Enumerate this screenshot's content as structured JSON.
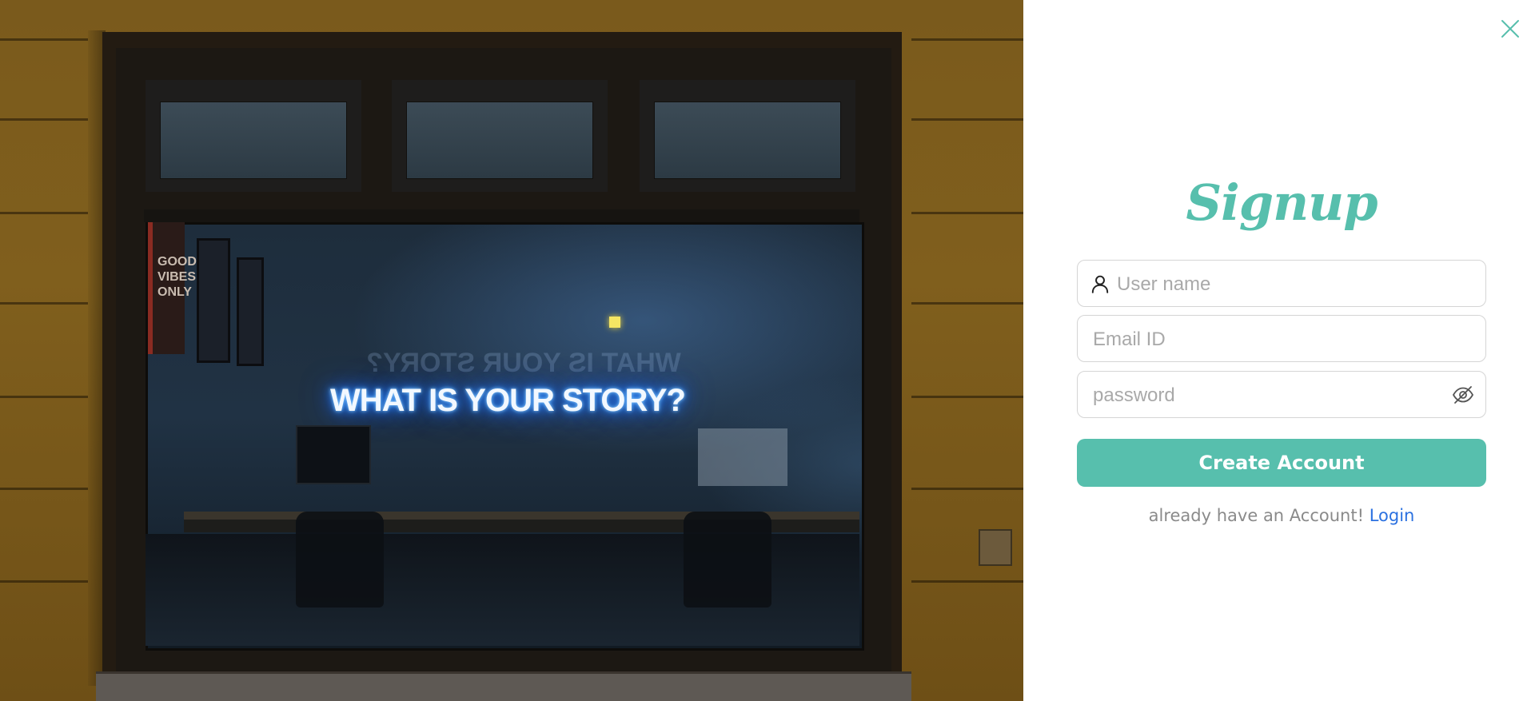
{
  "hero_image": {
    "neon_sign": "WHAT IS YOUR STORY?",
    "poster": "GOOD VIBES ONLY"
  },
  "signup": {
    "title": "Signup",
    "username_placeholder": "User name",
    "email_placeholder": "Email ID",
    "password_placeholder": "password",
    "submit_label": "Create Account",
    "login_prompt": "already have an Account!",
    "login_link": "Login"
  },
  "icons": {
    "close": "close-icon",
    "user": "user-icon",
    "password_toggle": "eye-off-icon"
  },
  "colors": {
    "accent": "#57bfad",
    "link": "#2b71e0",
    "muted_text": "#8a8a8a",
    "border": "#d5d5d5"
  }
}
